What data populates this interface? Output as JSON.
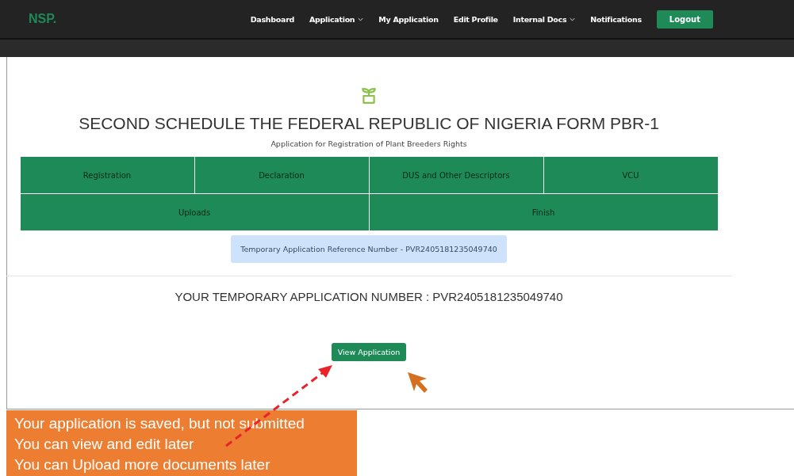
{
  "brand": "NSP.",
  "nav": [
    {
      "label": "Dashboard",
      "dropdown": false
    },
    {
      "label": "Application",
      "dropdown": true
    },
    {
      "label": "My Application",
      "dropdown": false
    },
    {
      "label": "Edit Profile",
      "dropdown": false
    },
    {
      "label": "Internal Docs",
      "dropdown": true
    },
    {
      "label": "Notifications",
      "dropdown": false
    }
  ],
  "logout": "Logout",
  "title": "SECOND SCHEDULE THE FEDERAL REPUBLIC OF NIGERIA FORM PBR-1",
  "subtitle": "Application for Registration of Plant Breeders Rights",
  "steps": [
    [
      "Registration",
      "Declaration",
      "DUS and Other Descriptors",
      "VCU"
    ],
    [
      "Uploads",
      "Finish"
    ]
  ],
  "reference": "Temporary Application Reference Number - PVR2405181235049740",
  "application_number": "YOUR TEMPORARY APPLICATION NUMBER : PVR2405181235049740",
  "view_button": "View Application",
  "annotation": [
    "Your application is saved, but not submitted",
    "You can view and edit later",
    "You can Upload  more documents later"
  ]
}
